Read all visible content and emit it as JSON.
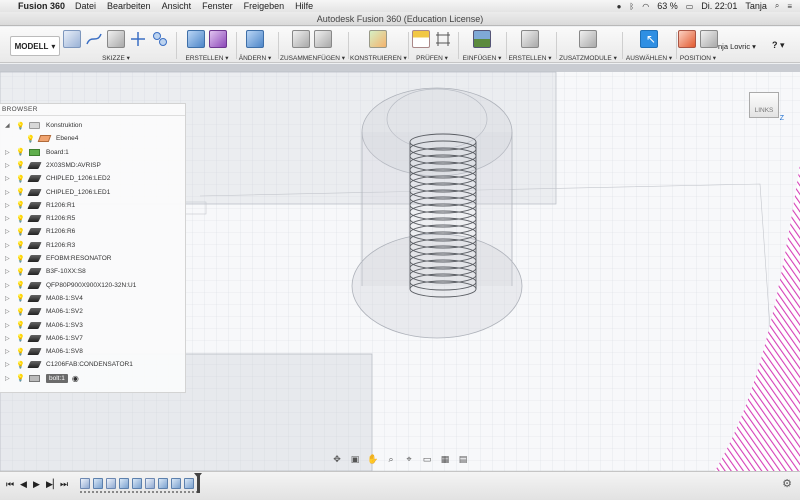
{
  "menubar": {
    "app_name": "Fusion 360",
    "menus": [
      "Datei",
      "Bearbeiten",
      "Ansicht",
      "Fenster",
      "Freigeben",
      "Hilfe"
    ],
    "battery": "63 %",
    "clock": "Di. 22:01",
    "user": "Tanja"
  },
  "window": {
    "title": "Autodesk Fusion 360 (Education License)"
  },
  "toolbar": {
    "mode_label": "MODELL",
    "groups": [
      {
        "label": "SKIZZE ▾"
      },
      {
        "label": "ERSTELLEN ▾"
      },
      {
        "label": "ÄNDERN ▾"
      },
      {
        "label": "ZUSAMMENFÜGEN ▾"
      },
      {
        "label": "KONSTRUIEREN ▾"
      },
      {
        "label": "PRÜFEN ▾"
      },
      {
        "label": "EINFÜGEN ▾"
      },
      {
        "label": "ERSTELLEN ▾"
      },
      {
        "label": "ZUSATZMODULE ▾"
      },
      {
        "label": "AUSWÄHLEN ▾"
      },
      {
        "label": "POSITION ▾"
      }
    ],
    "user_name": "nja Lovric ▾",
    "help": "? ▾"
  },
  "browser": {
    "title": "BROWSER",
    "items": [
      {
        "label": "Konstruktion",
        "kind": "folder"
      },
      {
        "label": "Ebene4",
        "kind": "plane"
      },
      {
        "label": "Board:1",
        "kind": "board"
      },
      {
        "label": "2X03SMD:AVRISP",
        "kind": "part"
      },
      {
        "label": "CHIPLED_1206:LED2",
        "kind": "part"
      },
      {
        "label": "CHIPLED_1206:LED1",
        "kind": "part"
      },
      {
        "label": "R1206:R1",
        "kind": "part"
      },
      {
        "label": "R1206:R5",
        "kind": "part"
      },
      {
        "label": "R1206:R6",
        "kind": "part"
      },
      {
        "label": "R1206:R3",
        "kind": "part"
      },
      {
        "label": "EFOBM:RESONATOR",
        "kind": "part"
      },
      {
        "label": "B3F-10XX:S8",
        "kind": "part"
      },
      {
        "label": "QFP80P900X900X120-32N:U1",
        "kind": "part"
      },
      {
        "label": "MA08-1:SV4",
        "kind": "part"
      },
      {
        "label": "MA06-1:SV2",
        "kind": "part"
      },
      {
        "label": "MA06-1:SV3",
        "kind": "part"
      },
      {
        "label": "MA06-1:SV7",
        "kind": "part"
      },
      {
        "label": "MA06-1:SV8",
        "kind": "part"
      },
      {
        "label": "C1206FAB:CONDENSATOR1",
        "kind": "part"
      },
      {
        "label": "bolt:1",
        "kind": "bolt"
      }
    ]
  },
  "viewcube": {
    "face_label": "LINKS",
    "axis_label": "Z"
  },
  "colors": {
    "accent": "#2f8fe3",
    "hatch": "#d63fb8"
  }
}
